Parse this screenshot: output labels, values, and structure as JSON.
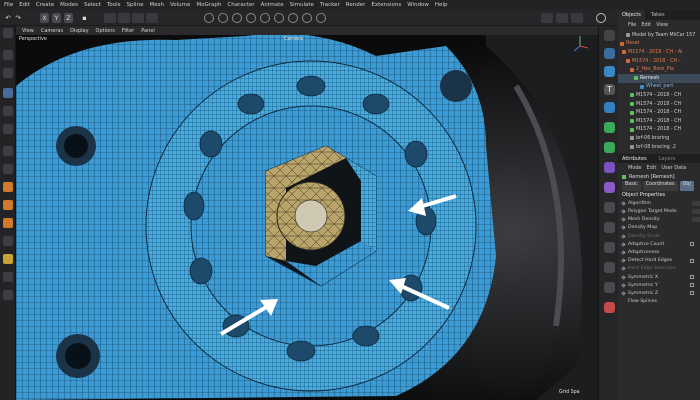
{
  "menubar": {
    "items": [
      "File",
      "Edit",
      "Create",
      "Modes",
      "Select",
      "Tools",
      "Spline",
      "Mesh",
      "Volume",
      "MoGraph",
      "Character",
      "Animate",
      "Simulate",
      "Tracker",
      "Render",
      "Extensions",
      "Window",
      "Help"
    ]
  },
  "toolbar": {
    "axis_labels": [
      "X",
      "Y",
      "Z"
    ]
  },
  "viewport": {
    "menu": [
      "View",
      "Cameras",
      "Display",
      "Options",
      "Filter",
      "Panel"
    ],
    "perspective_label": "Perspective",
    "camera_label": "Camera",
    "grid_label": "Grid Spa"
  },
  "objects": {
    "tabs": [
      "Objects",
      "Takes"
    ],
    "menu": [
      "File",
      "Edit",
      "View"
    ],
    "rows": [
      "Model by Team MiiCar 157",
      "Reset",
      "M1574 - 2018 - CH - Al",
      "M1574 - 2018 - CH -",
      "2_Hex_Bore_Pla",
      "Remesh",
      "Wheel_part",
      "M1574 - 2018 - CH",
      "M1574 - 2018 - CH",
      "M1574 - 2018 - CH",
      "M1574 - 2018 - CH",
      "M1574 - 2018 - CH",
      "brf-06 braring",
      "brf-08 bracing .2"
    ]
  },
  "attributes": {
    "header": "Attributes",
    "header_right": "Layers",
    "menu": [
      "Mode",
      "Edit",
      "User Data"
    ],
    "title": "Remesh [Remesh]",
    "tabs": [
      "Basic",
      "Coordinates",
      "Obj"
    ],
    "section": "Object Properties",
    "props": [
      {
        "label": "Algorithm",
        "dim": false
      },
      {
        "label": "Polygon Target Mode",
        "dim": false
      },
      {
        "label": "Mesh Density",
        "dim": false
      },
      {
        "label": "Density Map",
        "dim": false
      },
      {
        "label": "Density Scale",
        "dim": true
      },
      {
        "label": "Adaptive Count",
        "dim": false
      },
      {
        "label": "Adaptiveness",
        "dim": false
      },
      {
        "label": "Detect Hard Edges",
        "dim": false
      },
      {
        "label": "Hard Edge Selection",
        "dim": true
      },
      {
        "label": "Symmetric X",
        "dim": false
      },
      {
        "label": "Symmetric Y",
        "dim": false
      },
      {
        "label": "Symmetric Z",
        "dim": false
      },
      {
        "label": "Flow Splines",
        "dim": false
      }
    ]
  },
  "colors": {
    "mesh_blue": "#3a9bd6",
    "mesh_blue_light": "#4aaee3",
    "wire": "#0d2a3e",
    "hex_bore": "#b9a46a",
    "arrow": "#ffffff",
    "accent_select": "#5a6e88"
  }
}
